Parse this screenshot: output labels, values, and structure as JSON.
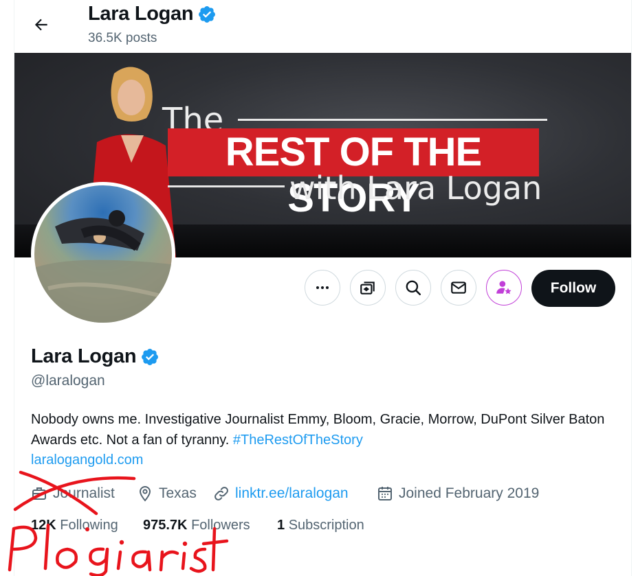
{
  "header": {
    "name": "Lara Logan",
    "posts": "36.5K posts"
  },
  "banner": {
    "the": "The",
    "title": "REST OF THE STORY",
    "with": "with Lara Logan"
  },
  "actions": {
    "follow_label": "Follow"
  },
  "profile": {
    "name": "Lara Logan",
    "handle": "@laralogan",
    "bio_text": "Nobody owns me. Investigative Journalist Emmy, Bloom, Gracie, Morrow, DuPont Silver Baton Awards etc. Not a fan of tyranny. ",
    "bio_hashtag": "#TheRestOfTheStory",
    "bio_url": "laralogangold.com",
    "category": "Journalist",
    "location": "Texas",
    "website": "linktr.ee/laralogan",
    "joined": "Joined February 2019"
  },
  "stats": {
    "following_count": "12K",
    "following_label": "Following",
    "followers_count": "975.7K",
    "followers_label": "Followers",
    "subscription_count": "1",
    "subscription_label": "Subscription"
  },
  "annotation": {
    "scrawl_text": "Plagiarist"
  },
  "colors": {
    "verified": "#1d9bf0",
    "link": "#1d9bf0",
    "subscribe_accent": "#c13fd8",
    "follow_bg": "#0f1419",
    "marker": "#e8141c",
    "banner_red": "#d32027"
  },
  "icons": {
    "back": "arrow-left-icon",
    "more": "more-dots-icon",
    "grok": "grok-icon",
    "search": "search-icon",
    "message": "envelope-icon",
    "subscribe": "subscribe-star-icon",
    "category": "briefcase-icon",
    "location": "location-pin-icon",
    "website": "link-icon",
    "joined": "calendar-icon"
  }
}
